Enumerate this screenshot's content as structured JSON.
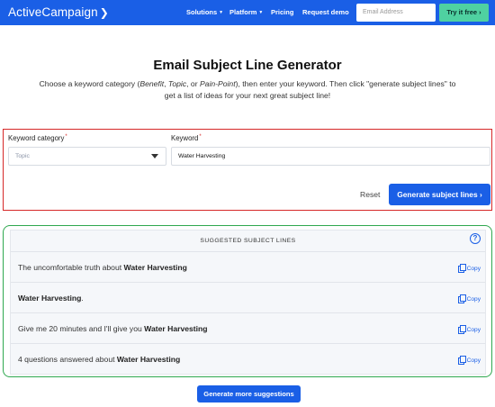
{
  "header": {
    "logo_text": "ActiveCampaign",
    "logo_icon": "chevron-right-icon",
    "nav": [
      {
        "label": "Solutions",
        "caret": true
      },
      {
        "label": "Platform",
        "caret": true
      },
      {
        "label": "Pricing",
        "caret": false
      },
      {
        "label": "Request demo",
        "caret": false
      }
    ],
    "email_placeholder": "Email Address",
    "try_label": "Try it free ›",
    "brand_color": "#1a5fe6",
    "cta_color": "#4fd1a1"
  },
  "page": {
    "title": "Email Subject Line Generator",
    "intro_part1": "Choose a keyword category (",
    "intro_benefit": "Benefit",
    "intro_sep1": ", ",
    "intro_topic": "Topic",
    "intro_sep2": ", or ",
    "intro_pain": "Pain-Point",
    "intro_part2": "), then enter your keyword. Then click \"generate subject lines\" to get a list of ideas for your next great subject line!"
  },
  "form": {
    "category_label": "Keyword category",
    "category_value": "Topic",
    "keyword_label": "Keyword",
    "keyword_value": "Water Harvesting",
    "required_mark": "*",
    "reset_label": "Reset",
    "generate_label": "Generate subject lines ›",
    "highlight_color": "#d62828"
  },
  "suggestions": {
    "header": "SUGGESTED SUBJECT LINES",
    "help_icon": "?",
    "copy_label": "Copy",
    "highlight_color": "#2fa84f",
    "rows": [
      {
        "pre": "The uncomfortable truth about ",
        "bold": "Water Harvesting",
        "post": ""
      },
      {
        "pre": "",
        "bold": "Water Harvesting",
        "post": "."
      },
      {
        "pre": "Give me 20 minutes and I'll give you ",
        "bold": "Water Harvesting",
        "post": ""
      },
      {
        "pre": "4 questions answered about ",
        "bold": "Water Harvesting",
        "post": ""
      }
    ],
    "more_label": "Generate more suggestions"
  }
}
